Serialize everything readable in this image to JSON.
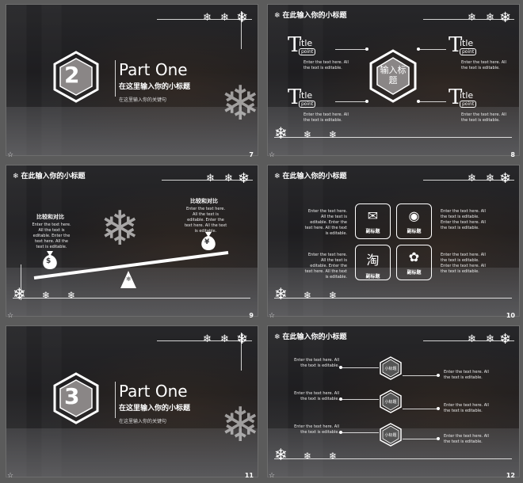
{
  "header_label": "在此输入你的小标题",
  "footer_star": "☆",
  "slides": {
    "s7": {
      "number": "7",
      "badge": "2",
      "part": "Part One",
      "subtitle": "在这里输入你的小标题",
      "keyword": "在这里输入你的关键句"
    },
    "s8": {
      "number": "8",
      "center": "输入标题",
      "titles": [
        {
          "t": "T",
          "itle": "itle",
          "point": "point",
          "text": "Enter the text here. All the text is editable."
        },
        {
          "t": "T",
          "itle": "itle",
          "point": "point",
          "text": "Enter the text here. All the text is editable."
        },
        {
          "t": "T",
          "itle": "itle",
          "point": "point",
          "text": "Enter the text here. All the text is editable."
        },
        {
          "t": "T",
          "itle": "itle",
          "point": "point",
          "text": "Enter the text here. All the text is editable."
        }
      ]
    },
    "s9": {
      "number": "9",
      "left_title": "比较和对比",
      "right_title": "比较和对比",
      "left_text": "Enter the text here. All the text is editable. Enter the text here. All the text is editable.",
      "right_text": "Enter the text here. All the text is editable. Enter the text here. All the text is editable.",
      "left_coin": "$",
      "right_coin": "¥"
    },
    "s10": {
      "number": "10",
      "boxes": [
        {
          "icon": "wechat-icon",
          "glyph": "✉",
          "label": "副标题"
        },
        {
          "icon": "weibo-icon",
          "glyph": "◉",
          "label": "副标题"
        },
        {
          "icon": "taobao-icon",
          "glyph": "淘",
          "label": "副标题"
        },
        {
          "icon": "paw-icon",
          "glyph": "✿",
          "label": "副标题"
        }
      ],
      "side_text": "Enter the text here. All the text is editable. Enter the text here. All the text is editable."
    },
    "s11": {
      "number": "11",
      "badge": "3",
      "part": "Part One",
      "subtitle": "在这里输入你的小标题",
      "keyword": "在这里输入你的关键句"
    },
    "s12": {
      "number": "12",
      "rows": [
        {
          "label": "小标题",
          "left": "Enter the text here. All the text is editable.",
          "right": "Enter the text here. All the text is editable."
        },
        {
          "label": "小标题",
          "left": "Enter the text here. All the text is editable.",
          "right": "Enter the text here. All the text is editable."
        },
        {
          "label": "小标题",
          "left": "Enter the text here. All the text is editable.",
          "right": "Enter the text here. All the text is editable."
        }
      ]
    }
  }
}
